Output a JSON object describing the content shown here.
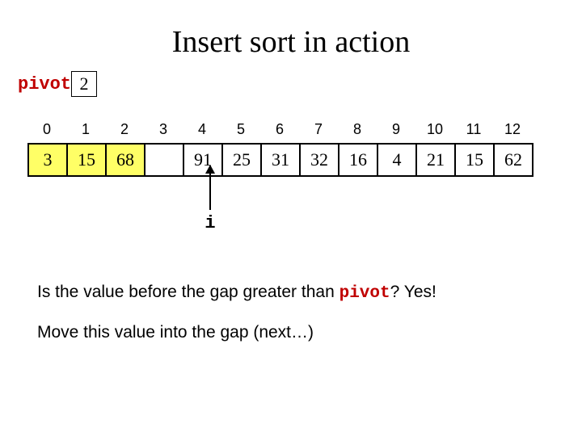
{
  "title": "Insert sort in action",
  "pivot": {
    "label": "pivot",
    "value": "2"
  },
  "indices": [
    "0",
    "1",
    "2",
    "3",
    "4",
    "5",
    "6",
    "7",
    "8",
    "9",
    "10",
    "11",
    "12"
  ],
  "cells": [
    {
      "v": "3",
      "sorted": true
    },
    {
      "v": "15",
      "sorted": true
    },
    {
      "v": "68",
      "sorted": true
    },
    {
      "v": "",
      "sorted": false
    },
    {
      "v": "91",
      "sorted": false
    },
    {
      "v": "25",
      "sorted": false
    },
    {
      "v": "31",
      "sorted": false
    },
    {
      "v": "32",
      "sorted": false
    },
    {
      "v": "16",
      "sorted": false
    },
    {
      "v": "4",
      "sorted": false
    },
    {
      "v": "21",
      "sorted": false
    },
    {
      "v": "15",
      "sorted": false
    },
    {
      "v": "62",
      "sorted": false
    }
  ],
  "pointer": {
    "label": "i",
    "index": 4
  },
  "caption1": {
    "pre": "Is the value before the gap greater than ",
    "kw": "pivot",
    "post": "? Yes!"
  },
  "caption2": "Move this value into the gap (next…)",
  "chart_data": {
    "type": "table",
    "title": "Insert sort in action",
    "pivot": 2,
    "pointer_i": 4,
    "indices": [
      0,
      1,
      2,
      3,
      4,
      5,
      6,
      7,
      8,
      9,
      10,
      11,
      12
    ],
    "values": [
      3,
      15,
      68,
      null,
      91,
      25,
      31,
      32,
      16,
      4,
      21,
      15,
      62
    ],
    "sorted_prefix_end": 2
  }
}
